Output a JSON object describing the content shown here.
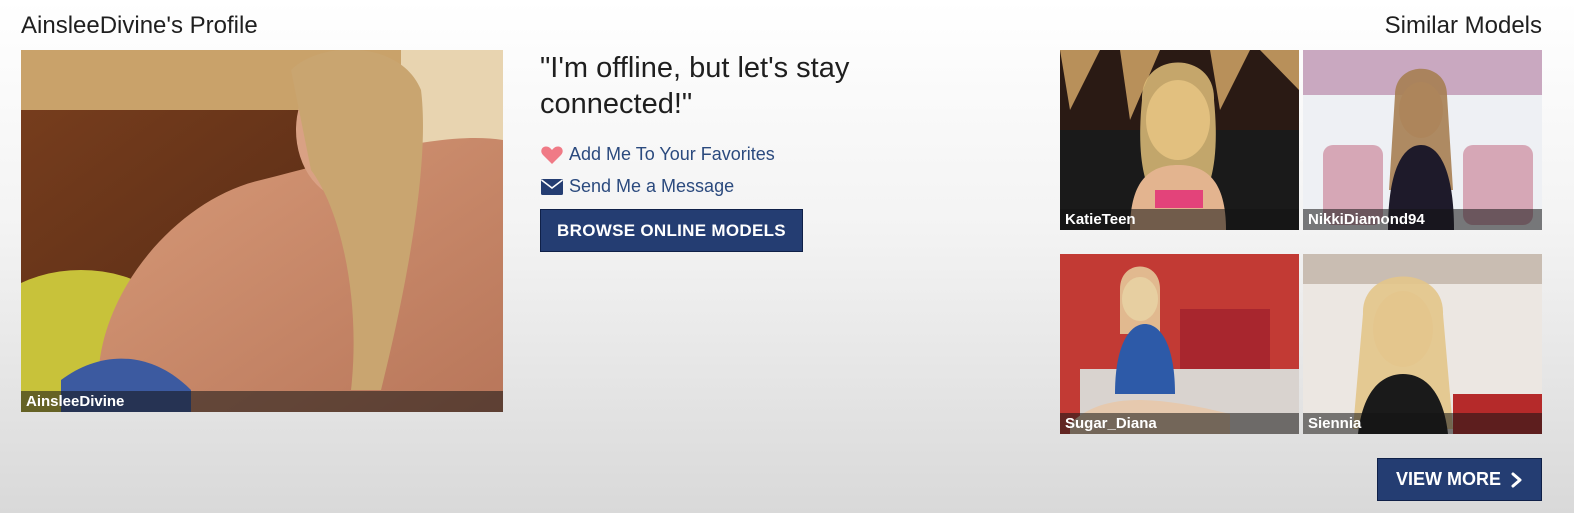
{
  "profile": {
    "title": "AinsleeDivine's Profile",
    "photo_caption": "AinsleeDivine"
  },
  "status": {
    "message": "\"I'm offline, but let's stay connected!\""
  },
  "actions": {
    "favorites_label": "Add Me To Your Favorites",
    "favorites_icon": "heart-icon",
    "message_label": "Send Me a Message",
    "message_icon": "envelope-icon",
    "browse_label": "BROWSE ONLINE MODELS"
  },
  "similar": {
    "title": "Similar Models",
    "models": [
      {
        "name": "KatieTeen"
      },
      {
        "name": "NikkiDiamond94"
      },
      {
        "name": "Sugar_Diana"
      },
      {
        "name": "Siennia"
      }
    ],
    "view_more_label": "VIEW MORE",
    "view_more_icon": "chevron-right-icon"
  },
  "colors": {
    "accent": "#243d72",
    "link": "#2b4a7e",
    "heart": "#f07a86"
  }
}
